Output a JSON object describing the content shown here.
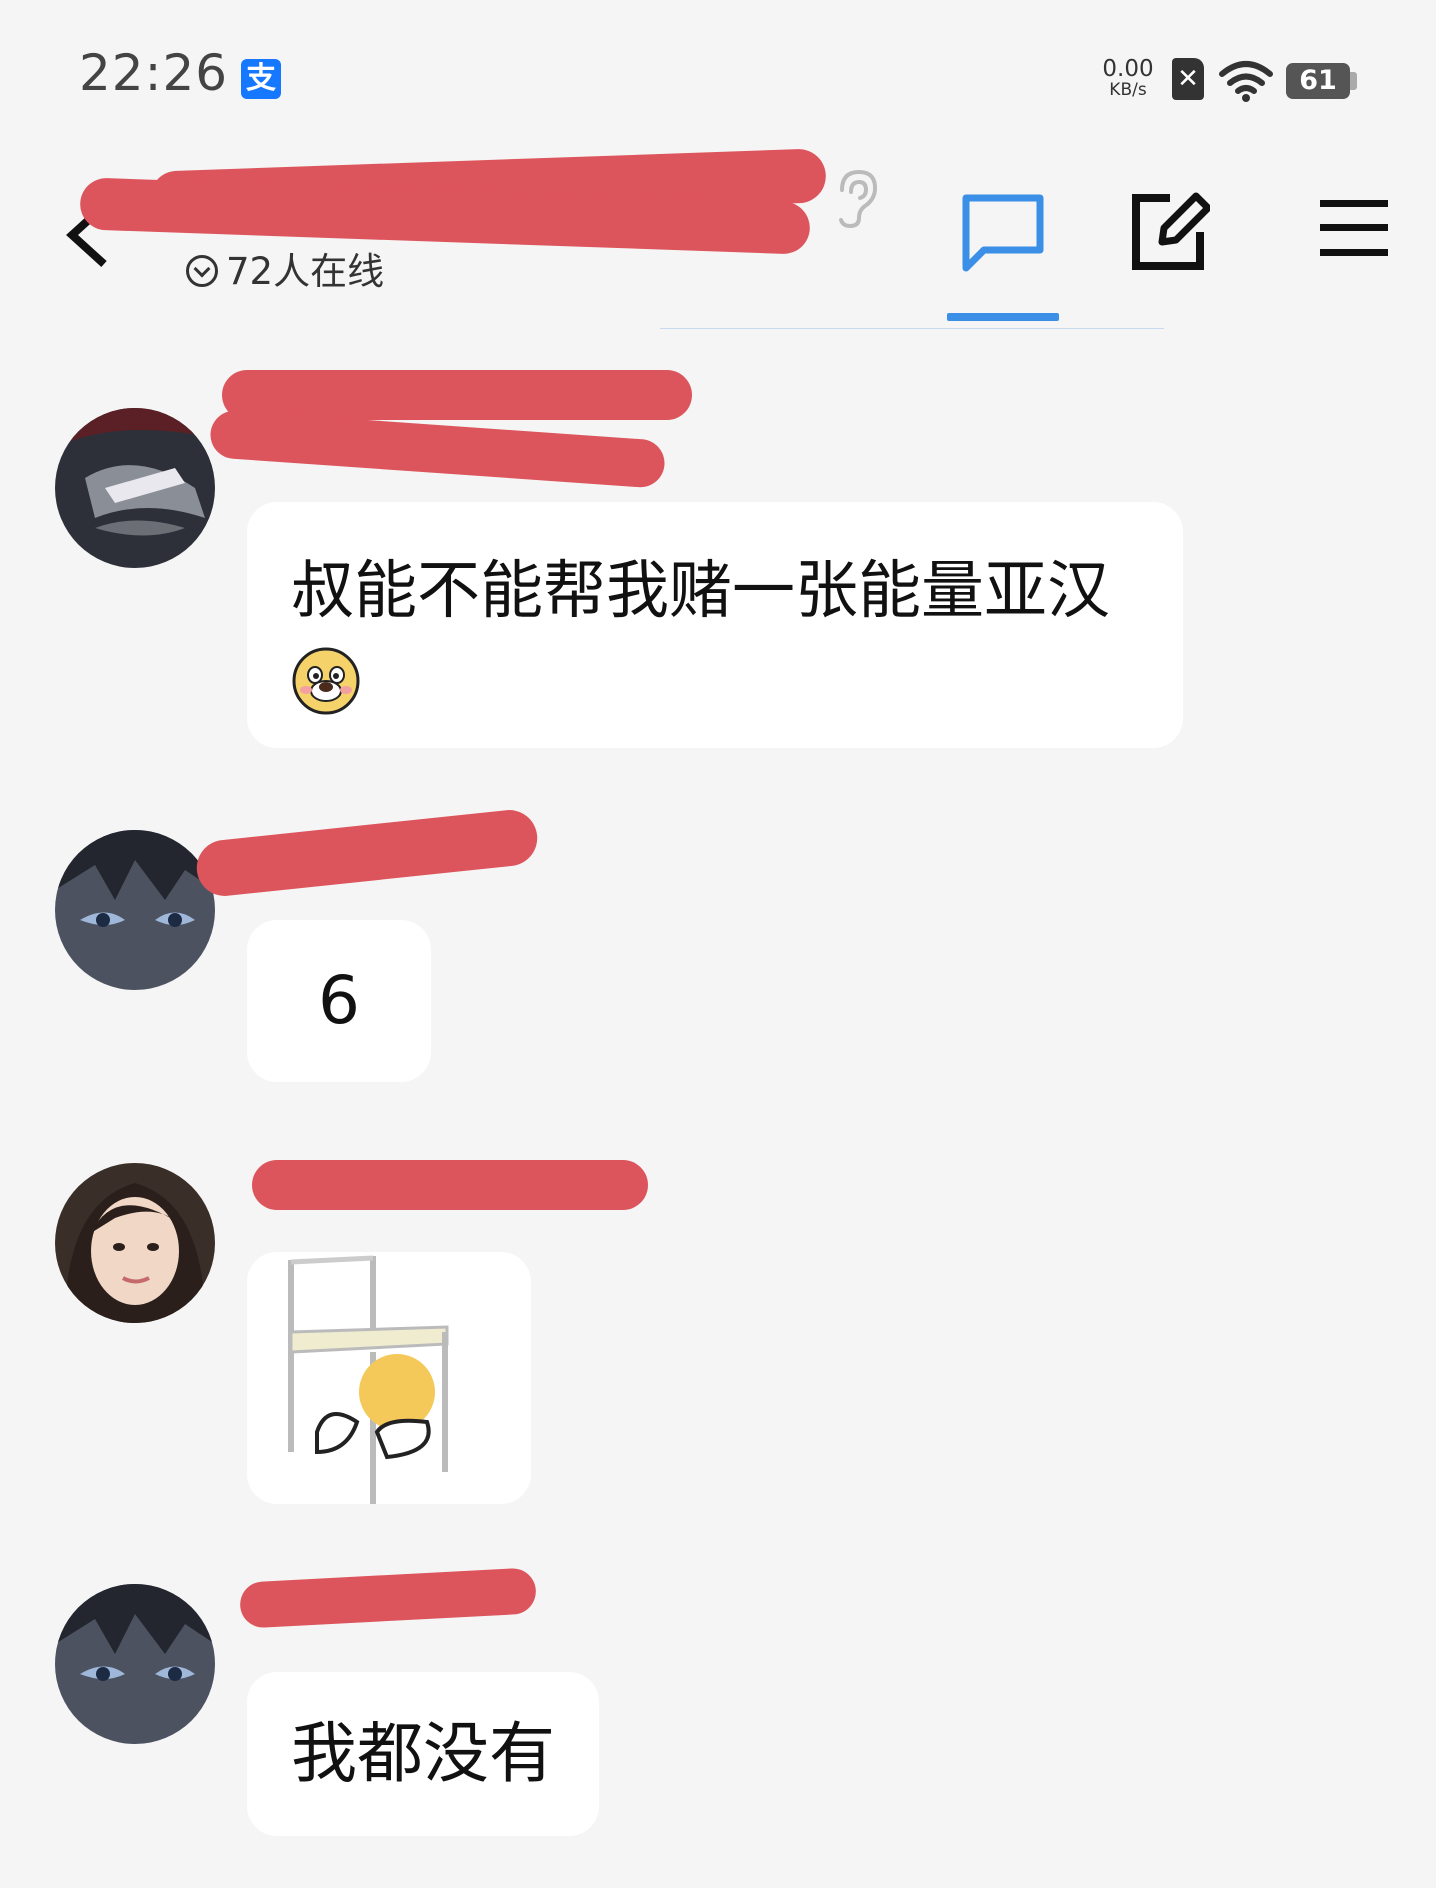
{
  "status_bar": {
    "time": "22:26",
    "alipay_icon_glyph": "支",
    "net_speed_value": "0.00",
    "net_speed_unit": "KB/s",
    "battery_level": "61",
    "icons": [
      "alipay-icon",
      "sim-icon",
      "wifi-icon",
      "battery-icon"
    ]
  },
  "header": {
    "group_name": "",
    "online_status": "72人在线",
    "icons": [
      "back-icon",
      "ear-icon",
      "chat-icon",
      "compose-icon",
      "menu-icon"
    ],
    "active_tab_color": "#3b8fe6"
  },
  "messages": [
    {
      "sender": "",
      "text": "叔能不能帮我赌一张能量亚汉",
      "emoji": "dog-face-emoji"
    },
    {
      "sender": "",
      "text": "6"
    },
    {
      "sender": "",
      "image": "chair-meme-sticker"
    },
    {
      "sender": "",
      "text": "我都没有"
    }
  ],
  "colors": {
    "background": "#f5f5f5",
    "bubble": "#ffffff",
    "redaction": "#dd555c"
  }
}
